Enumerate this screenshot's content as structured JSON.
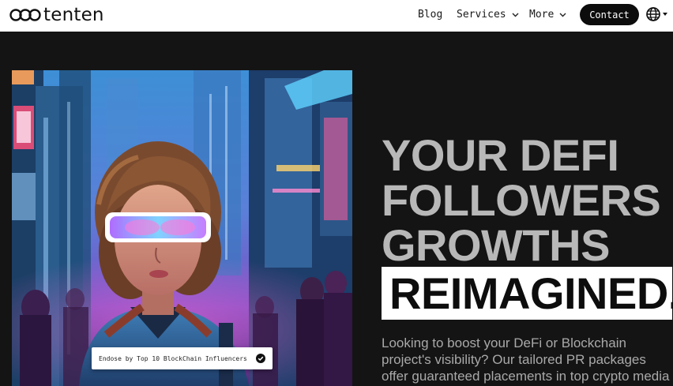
{
  "nav": {
    "logo_text": "tenten",
    "links": [
      {
        "label": "Blog"
      },
      {
        "label": "Services"
      },
      {
        "label": "More"
      }
    ],
    "contact_label": "Contact",
    "language_icon": "globe-icon"
  },
  "hero": {
    "badge_text": "Endose by Top 10 BlockChain Influencers",
    "headline_lines": [
      "YOUR DEFI",
      "FOLLOWERS",
      "GROWTHS"
    ],
    "highlight": "REIMAGINED.",
    "description": "Looking to boost your DeFi or Blockchain project's visibility? Our tailored PR packages offer guaranteed placements in top crypto media"
  },
  "colors": {
    "background": "#141414",
    "nav_background": "#ffffff",
    "headline_gray": "#b8b8b8",
    "contact_button": "#0c0c0c"
  }
}
